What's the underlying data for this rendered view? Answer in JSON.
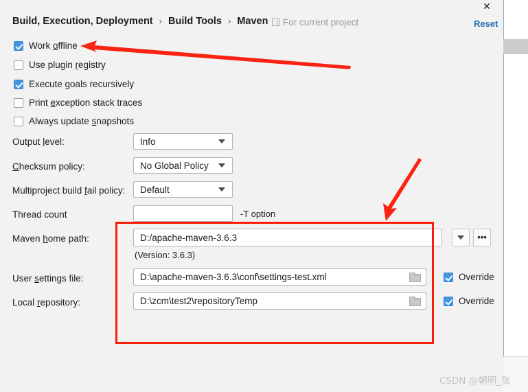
{
  "window": {
    "close_label": "✕",
    "reset_label": "Reset"
  },
  "breadcrumb": {
    "crumbs": [
      "Build, Execution, Deployment",
      "Build Tools",
      "Maven"
    ],
    "separator": "›"
  },
  "scope": {
    "icon": "module-icon",
    "label": "For current project"
  },
  "checkboxes": [
    {
      "label_pre": "Work ",
      "label_mnemonic": "o",
      "label_post": "ffline",
      "checked": true
    },
    {
      "label_pre": "Use plugin ",
      "label_mnemonic": "r",
      "label_post": "egistry",
      "checked": false
    },
    {
      "label_pre": "Execute ",
      "label_mnemonic": "g",
      "label_post": "oals recursively",
      "checked": true
    },
    {
      "label_pre": "Print ",
      "label_mnemonic": "e",
      "label_post": "xception stack traces",
      "checked": false
    },
    {
      "label_pre": "Always update ",
      "label_mnemonic": "s",
      "label_post": "napshots",
      "checked": false
    }
  ],
  "fields": {
    "output_level": {
      "label_pre": "Output ",
      "label_mnemonic": "l",
      "label_post": "evel:",
      "value": "Info",
      "options": [
        "Info"
      ]
    },
    "checksum_policy": {
      "label_pre": "",
      "label_mnemonic": "C",
      "label_post": "hecksum policy:",
      "value": "No Global Policy",
      "options": [
        "No Global Policy"
      ]
    },
    "multiproject_fail_policy": {
      "label_pre": "Multiproject build ",
      "label_mnemonic": "f",
      "label_post": "ail policy:",
      "value": "Default",
      "options": [
        "Default"
      ]
    },
    "thread_count": {
      "label_pre": "Thread count",
      "label_mnemonic": "",
      "label_post": "",
      "value": "",
      "suffix": "-T option"
    },
    "maven_home_path": {
      "label_pre": "Maven ",
      "label_mnemonic": "h",
      "label_post": "ome path:",
      "value": "D:/apache-maven-3.6.3",
      "version_hint": "(Version: 3.6.3)",
      "browse_label": "•••"
    },
    "user_settings_file": {
      "label_pre": "User ",
      "label_mnemonic": "s",
      "label_post": "ettings file:",
      "value": "D:\\apache-maven-3.6.3\\conf\\settings-test.xml",
      "override_label": "Override",
      "override_checked": true
    },
    "local_repository": {
      "label_pre": "Local ",
      "label_mnemonic": "r",
      "label_post": "epository:",
      "value": "D:\\zcm\\test2\\repositoryTemp",
      "override_label": "Override",
      "override_checked": true
    }
  },
  "annotations": {
    "highlight_box_color": "#f81f09",
    "arrow_color": "#fb2313",
    "arrow_count": 2
  },
  "watermark": {
    "text": "CSDN @朝明_张"
  },
  "colors": {
    "dialog_bg": "#f2f2f2",
    "checkbox_accent": "#4495e0",
    "link_accent": "#2470b3",
    "text": "#1c1c1c"
  }
}
